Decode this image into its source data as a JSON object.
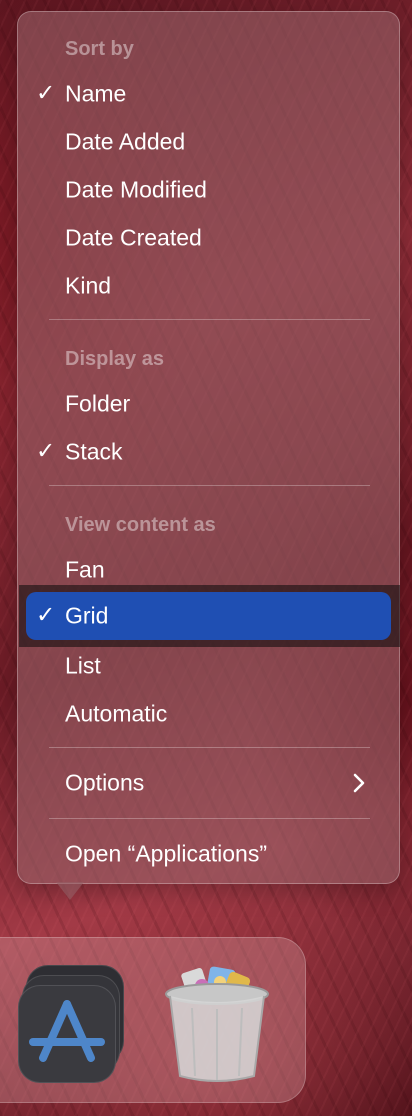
{
  "menu": {
    "sort_header": "Sort by",
    "sort_items": [
      {
        "label": "Name",
        "checked": true
      },
      {
        "label": "Date Added",
        "checked": false
      },
      {
        "label": "Date Modified",
        "checked": false
      },
      {
        "label": "Date Created",
        "checked": false
      },
      {
        "label": "Kind",
        "checked": false
      }
    ],
    "display_header": "Display as",
    "display_items": [
      {
        "label": "Folder",
        "checked": false
      },
      {
        "label": "Stack",
        "checked": true
      }
    ],
    "view_header": "View content as",
    "view_items": [
      {
        "label": "Fan",
        "checked": false
      },
      {
        "label": "Grid",
        "checked": true,
        "highlighted": true
      },
      {
        "label": "List",
        "checked": false
      },
      {
        "label": "Automatic",
        "checked": false
      }
    ],
    "options_label": "Options",
    "open_label": "Open “Applications”",
    "check_glyph": "✓",
    "highlight_color": "#1f4fb3"
  },
  "dock": {
    "items": [
      {
        "icon": "app-store-stack-icon"
      },
      {
        "icon": "trash-full-icon"
      }
    ]
  }
}
